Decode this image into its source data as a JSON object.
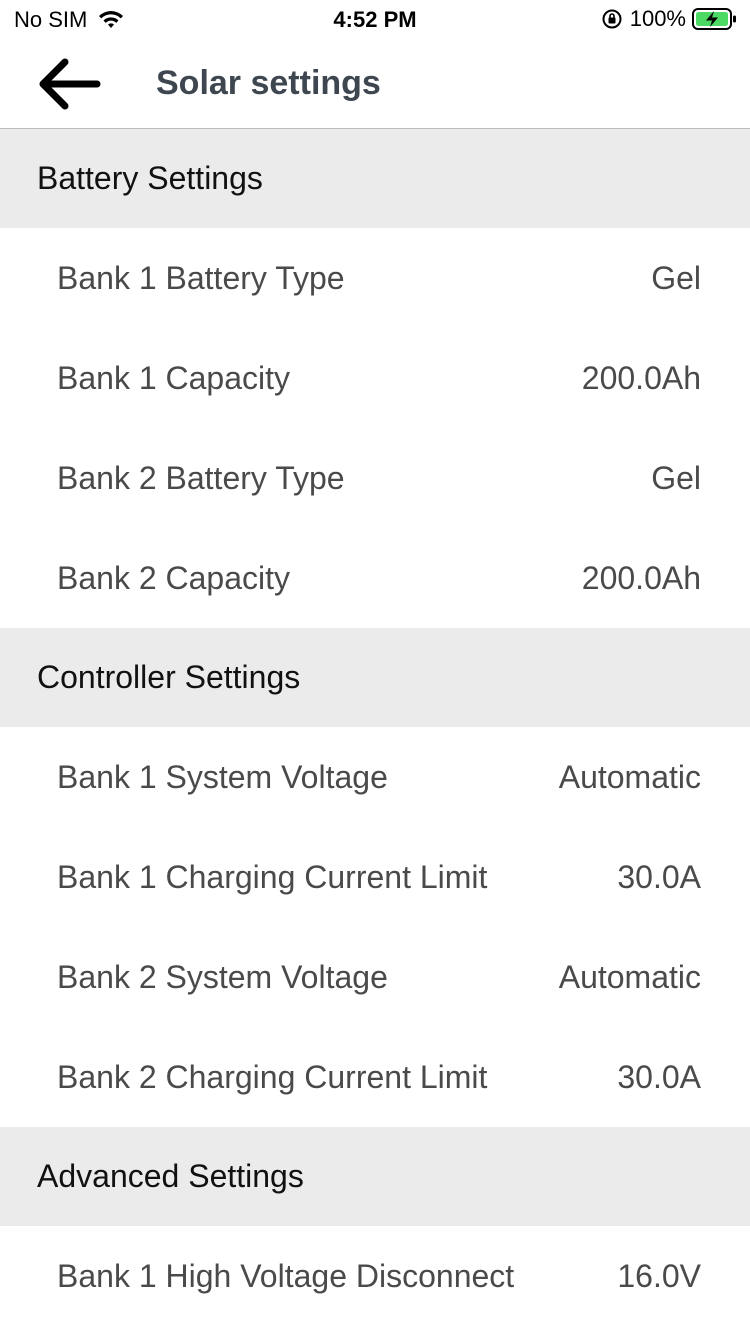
{
  "status_bar": {
    "carrier": "No SIM",
    "time": "4:52 PM",
    "battery_percent": "100%"
  },
  "nav": {
    "title": "Solar settings"
  },
  "sections": [
    {
      "header": "Battery Settings",
      "rows": [
        {
          "label": "Bank 1 Battery Type",
          "value": "Gel"
        },
        {
          "label": "Bank 1 Capacity",
          "value": "200.0Ah"
        },
        {
          "label": "Bank 2 Battery Type",
          "value": "Gel"
        },
        {
          "label": "Bank 2 Capacity",
          "value": "200.0Ah"
        }
      ]
    },
    {
      "header": "Controller Settings",
      "rows": [
        {
          "label": "Bank 1 System Voltage",
          "value": "Automatic"
        },
        {
          "label": "Bank 1 Charging Current Limit",
          "value": "30.0A"
        },
        {
          "label": "Bank 2 System Voltage",
          "value": "Automatic"
        },
        {
          "label": "Bank 2 Charging Current Limit",
          "value": "30.0A"
        }
      ]
    },
    {
      "header": "Advanced Settings",
      "rows": [
        {
          "label": "Bank 1 High Voltage Disconnect",
          "value": "16.0V"
        }
      ]
    }
  ],
  "icons": {
    "back": "arrow-left-icon",
    "wifi": "wifi-icon",
    "orientation_lock": "orientation-lock-icon",
    "battery": "battery-charging-icon"
  },
  "colors": {
    "section_bg": "#ebebeb",
    "battery_fill": "#4cd964",
    "title": "#3e4650"
  }
}
